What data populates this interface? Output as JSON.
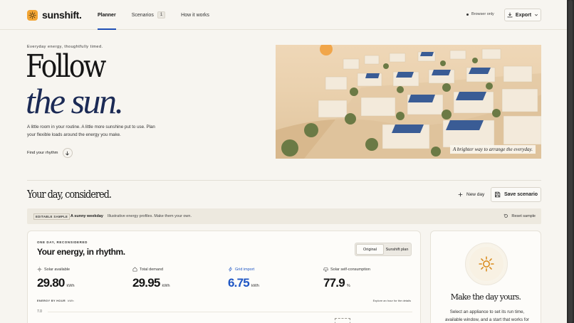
{
  "header": {
    "logo_text": "sunshift.",
    "nav": [
      {
        "label": "Planner",
        "active": true
      },
      {
        "label": "Scenarios",
        "badge": "1"
      },
      {
        "label": "How it works"
      }
    ],
    "browser_only": "Browser only",
    "export_label": "Export"
  },
  "hero": {
    "eyebrow": "Everyday energy, thoughtfully timed.",
    "title_line1": "Follow",
    "title_line2": "the sun.",
    "description": "A little room in your routine. A little more sunshine put to use. Plan your flexible loads around the energy you make.",
    "cta": "Find your rhythm",
    "image_caption": "A brighter way to arrange the everyday."
  },
  "day_section": {
    "title": "Your day, considered.",
    "new_day_label": "New day",
    "save_label": "Save scenario"
  },
  "sample_bar": {
    "tag": "EDITABLE SAMPLE",
    "name": "A sunny weekday",
    "note": "Illustrative energy profiles. Make them your own.",
    "reset_label": "Reset sample"
  },
  "main_card": {
    "eyebrow": "ONE DAY, RECONSIDERED",
    "title": "Your energy, in rhythm.",
    "toggle": [
      "Original",
      "Sunshift plan"
    ],
    "stats": [
      {
        "label": "Solar available",
        "value": "29.80",
        "unit": "kWh"
      },
      {
        "label": "Total demand",
        "value": "29.95",
        "unit": "kWh"
      },
      {
        "label": "Grid import",
        "value": "6.75",
        "unit": "kWh"
      },
      {
        "label": "Solar self-consumption",
        "value": "77.9",
        "unit": "%"
      }
    ],
    "chart_label": "ENERGY BY HOUR",
    "chart_unit": "kWh",
    "explore": "Explore an hour for the details",
    "ytick": "7.0"
  },
  "side_card": {
    "title": "Make the day yours.",
    "description": "Select an appliance to set its run time, available window, and a start that works for"
  },
  "colors": {
    "accent": "#1f4fb5",
    "sun": "#f2a534",
    "import": "#1f56c4"
  }
}
